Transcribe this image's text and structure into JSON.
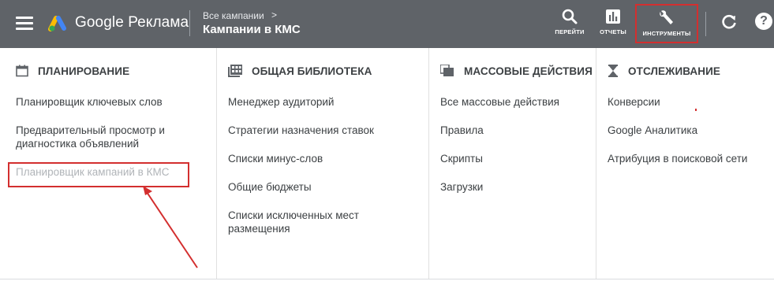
{
  "header": {
    "brand": "Google Реклама",
    "breadcrumb_parent": "Все кампании",
    "breadcrumb_arrow": ">",
    "breadcrumb_current": "Кампании в КМС",
    "tools": {
      "goto_label": "ПЕРЕЙТИ",
      "reports_label": "ОТЧЕТЫ",
      "tools_label": "ИНСТРУМЕНТЫ"
    },
    "help_symbol": "?"
  },
  "menu": {
    "planning": {
      "title": "ПЛАНИРОВАНИЕ",
      "icon": "calendar-icon",
      "items": [
        "Планировщик ключевых слов",
        "Предварительный просмотр и диагностика объявлений",
        "Планировщик кампаний в КМС"
      ]
    },
    "library": {
      "title": "ОБЩАЯ БИБЛИОТЕКА",
      "icon": "library-icon",
      "items": [
        "Менеджер аудиторий",
        "Стратегии назначения ставок",
        "Списки минус-слов",
        "Общие бюджеты",
        "Списки исключенных мест размещения"
      ]
    },
    "bulk": {
      "title": "МАССОВЫЕ ДЕЙСТВИЯ",
      "icon": "bulk-actions-icon",
      "items": [
        "Все массовые действия",
        "Правила",
        "Скрипты",
        "Загрузки"
      ]
    },
    "tracking": {
      "title": "ОТСЛЕЖИВАНИЕ",
      "icon": "hourglass-icon",
      "items": [
        "Конверсии",
        "Google Аналитика",
        "Атрибуция в поисковой сети"
      ]
    }
  },
  "colors": {
    "header_bg": "#5f6368",
    "annotation_red": "#d32f2f",
    "text": "#3c4043",
    "disabled_text": "#b0b4b8"
  }
}
